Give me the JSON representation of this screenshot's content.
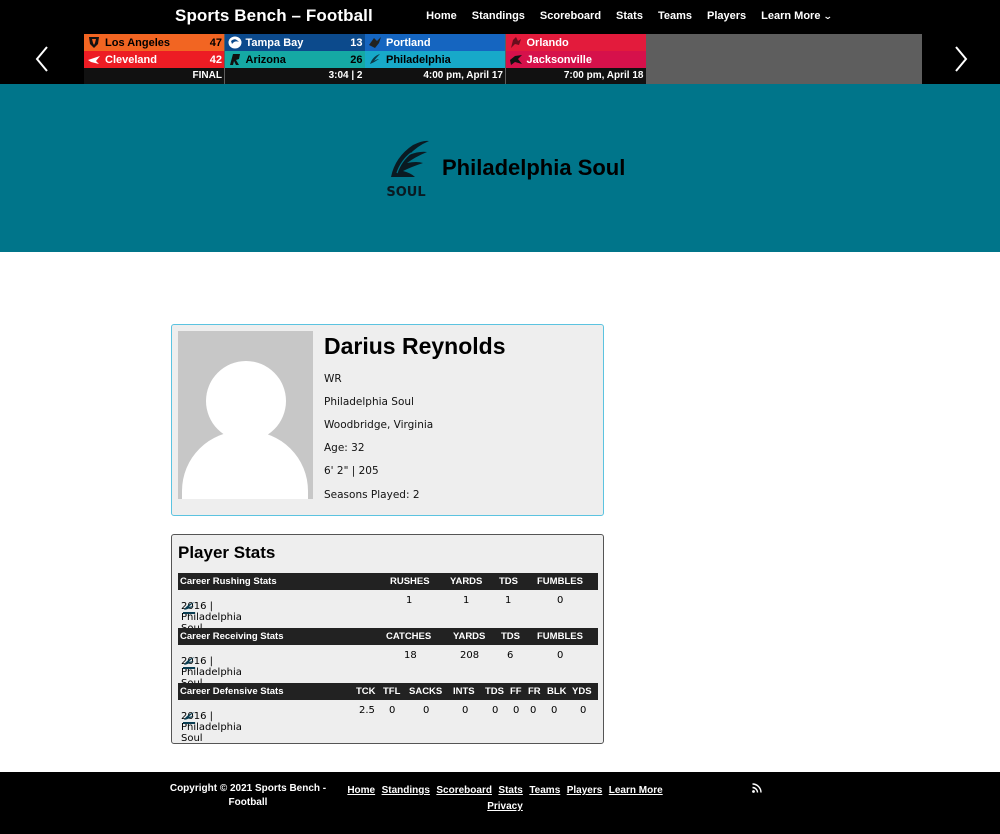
{
  "header": {
    "site_title": "Sports Bench – Football",
    "nav": [
      {
        "label": "Home"
      },
      {
        "label": "Standings"
      },
      {
        "label": "Scoreboard"
      },
      {
        "label": "Stats"
      },
      {
        "label": "Teams"
      },
      {
        "label": "Players"
      },
      {
        "label": "Learn More"
      }
    ]
  },
  "ticker": {
    "games": [
      {
        "away": {
          "name": "Los Angeles",
          "score": "47",
          "color": "#f26522"
        },
        "home": {
          "name": "Cleveland",
          "score": "42",
          "color": "#ed1c24"
        },
        "status": "FINAL"
      },
      {
        "away": {
          "name": "Tampa Bay",
          "score": "13",
          "color": "#0c4a8c"
        },
        "home": {
          "name": "Arizona",
          "score": "26",
          "color": "#15a9a4"
        },
        "status": "3:04 | 2"
      },
      {
        "away": {
          "name": "Portland",
          "score": "",
          "color": "#1565c0"
        },
        "home": {
          "name": "Philadelphia",
          "score": "",
          "color": "#17a9c9"
        },
        "status": "4:00 pm, April 17"
      },
      {
        "away": {
          "name": "Orlando",
          "score": "",
          "color": "#e31b3c"
        },
        "home": {
          "name": "Jacksonville",
          "score": "",
          "color": "#d6114b"
        },
        "status": "7:00 pm, April 18"
      }
    ]
  },
  "hero": {
    "team_name": "Philadelphia Soul",
    "logo_text": "SOUL",
    "background": "#00758a"
  },
  "player": {
    "name": "Darius Reynolds",
    "position": "WR",
    "team": "Philadelphia Soul",
    "hometown": "Woodbridge, Virginia",
    "age": "Age: 32",
    "size": "6' 2\" | 205",
    "seasons": "Seasons Played: 2"
  },
  "stats": {
    "title": "Player Stats",
    "rushing": {
      "heading": "Career Rushing Stats",
      "columns": [
        "RUSHES",
        "YARDS",
        "TDS",
        "FUMBLES"
      ],
      "row": {
        "team": "2016 | Philadelphia Soul",
        "values": [
          "1",
          "1",
          "1",
          "0"
        ]
      }
    },
    "receiving": {
      "heading": "Career Receiving Stats",
      "columns": [
        "CATCHES",
        "YARDS",
        "TDS",
        "FUMBLES"
      ],
      "row": {
        "team": "2016 | Philadelphia Soul",
        "values": [
          "18",
          "208",
          "6",
          "0"
        ]
      }
    },
    "defensive": {
      "heading": "Career Defensive Stats",
      "columns": [
        "TCK",
        "TFL",
        "SACKS",
        "INTS",
        "TDS",
        "FF",
        "FR",
        "BLK",
        "YDS"
      ],
      "row": {
        "team": "2016 | Philadelphia Soul",
        "values": [
          "2.5",
          "0",
          "0",
          "0",
          "0",
          "0",
          "0",
          "0",
          "0"
        ]
      }
    }
  },
  "footer": {
    "copyright": "Copyright © 2021 Sports Bench - Football",
    "links": [
      "Home",
      "Standings",
      "Scoreboard",
      "Stats",
      "Teams",
      "Players",
      "Learn More",
      "Privacy"
    ]
  }
}
